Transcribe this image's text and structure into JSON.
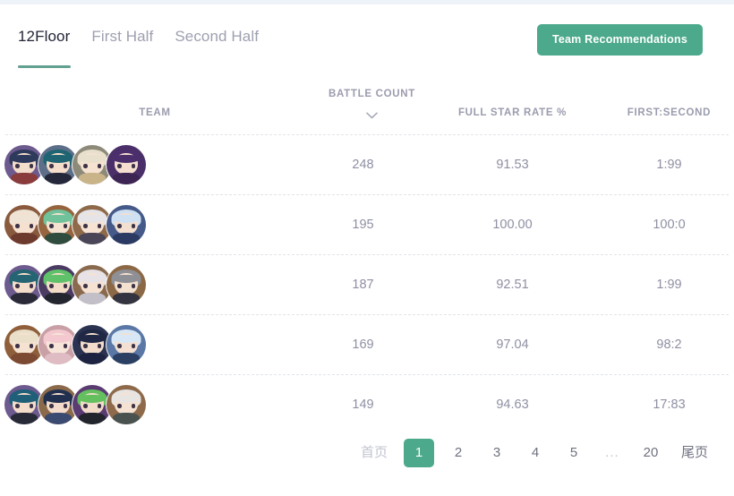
{
  "header": {
    "tabs": [
      {
        "label": "12Floor",
        "active": true
      },
      {
        "label": "First Half",
        "active": false
      },
      {
        "label": "Second Half",
        "active": false
      }
    ],
    "recommend_button": "Team Recommendations",
    "accent_color": "#4ca98b",
    "underline_color": "#62a090"
  },
  "table": {
    "columns": [
      {
        "key": "team",
        "label": "TEAM"
      },
      {
        "key": "battle_count",
        "label": "BATTLE COUNT",
        "sort_icon": "chevron-down-icon",
        "sorted": true
      },
      {
        "key": "full_star_rate",
        "label": "FULL STAR RATE %"
      },
      {
        "key": "first_second",
        "label": "FIRST:SECOND"
      }
    ],
    "rows": [
      {
        "battle_count": "248",
        "full_star_rate": "91.53",
        "first_second": "1:99",
        "team": [
          {
            "bg": "#6d5a8e",
            "hair": "#2e3a5c",
            "body": "#8a3b3b",
            "skin": "#f3ddcb"
          },
          {
            "bg": "#5d6f88",
            "hair": "#1e6472",
            "body": "#25283a",
            "skin": "#f4ddcb"
          },
          {
            "bg": "#8e8a7a",
            "hair": "#e8e0cc",
            "body": "#c9b48a",
            "skin": "#f6e2d1"
          },
          {
            "bg": "#4a2f68",
            "hair": "#4b2f6d",
            "body": "#3d2553",
            "skin": "#f5ded0"
          }
        ]
      },
      {
        "battle_count": "195",
        "full_star_rate": "100.00",
        "first_second": "100:0",
        "team": [
          {
            "bg": "#8a5a3e",
            "hair": "#efe3d5",
            "body": "#6d3b2e",
            "skin": "#f6e0cf"
          },
          {
            "bg": "#96653f",
            "hair": "#6fc29a",
            "body": "#2f4c3f",
            "skin": "#f5e1cf"
          },
          {
            "bg": "#8e6a4b",
            "hair": "#e6e4e6",
            "body": "#4a4657",
            "skin": "#f6e3d2"
          },
          {
            "bg": "#455a88",
            "hair": "#cfe0f2",
            "body": "#2a3a63",
            "skin": "#f3dfd0"
          }
        ]
      },
      {
        "battle_count": "187",
        "full_star_rate": "92.51",
        "first_second": "1:99",
        "team": [
          {
            "bg": "#6d5a8e",
            "hair": "#256472",
            "body": "#2b2a38",
            "skin": "#f4ddca"
          },
          {
            "bg": "#4b3b63",
            "hair": "#5fc169",
            "body": "#23252f",
            "skin": "#f2dcc8"
          },
          {
            "bg": "#8a6a4e",
            "hair": "#e7e2e6",
            "body": "#c2bfc9",
            "skin": "#f6e2d2"
          },
          {
            "bg": "#8c6946",
            "hair": "#8f8f96",
            "body": "#33343f",
            "skin": "#f4e0cf"
          }
        ]
      },
      {
        "battle_count": "169",
        "full_star_rate": "97.04",
        "first_second": "98:2",
        "team": [
          {
            "bg": "#8f5f3b",
            "hair": "#eadfc9",
            "body": "#7c4a33",
            "skin": "#f6e2d0"
          },
          {
            "bg": "#c8a0a6",
            "hair": "#f3c9cf",
            "body": "#dfbcc3",
            "skin": "#f8e5da"
          },
          {
            "bg": "#2b3350",
            "hair": "#202845",
            "body": "#1d2340",
            "skin": "#f2dccb"
          },
          {
            "bg": "#5a77a6",
            "hair": "#d7e7f5",
            "body": "#2b3f63",
            "skin": "#f3e0d2"
          }
        ]
      },
      {
        "battle_count": "149",
        "full_star_rate": "94.63",
        "first_second": "17:83",
        "team": [
          {
            "bg": "#6d5a8e",
            "hair": "#1f5f78",
            "body": "#282a38",
            "skin": "#f4ddca"
          },
          {
            "bg": "#8a6a4a",
            "hair": "#22304f",
            "body": "#3b4a70",
            "skin": "#f3dccb"
          },
          {
            "bg": "#5b3c72",
            "hair": "#64c05f",
            "body": "#22252c",
            "skin": "#f2dcc9"
          },
          {
            "bg": "#8e6a4b",
            "hair": "#e8e4e2",
            "body": "#4a5250",
            "skin": "#f6e2d2"
          }
        ]
      }
    ]
  },
  "pagination": {
    "items": [
      {
        "label": "首页",
        "state": "muted"
      },
      {
        "label": "1",
        "state": "active"
      },
      {
        "label": "2",
        "state": "normal"
      },
      {
        "label": "3",
        "state": "normal"
      },
      {
        "label": "4",
        "state": "normal"
      },
      {
        "label": "5",
        "state": "normal"
      },
      {
        "label": "...",
        "state": "ellipsis"
      },
      {
        "label": "20",
        "state": "normal"
      },
      {
        "label": "尾页",
        "state": "normal"
      }
    ]
  }
}
